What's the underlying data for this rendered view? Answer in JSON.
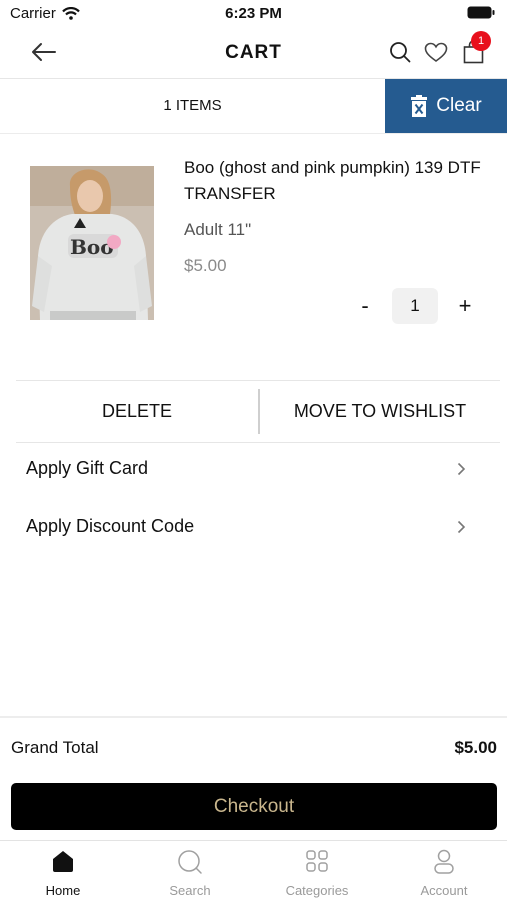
{
  "status_bar": {
    "carrier": "Carrier",
    "time": "6:23 PM"
  },
  "header": {
    "title": "CART",
    "cart_badge": "1"
  },
  "items_bar": {
    "count": "1 ITEMS",
    "clear_label": "Clear"
  },
  "product": {
    "name": "Boo (ghost and pink pumpkin) 139 DTF TRANSFER",
    "variant": "Adult 11\"",
    "price": "$5.00",
    "quantity": "1",
    "minus": "-",
    "plus": "+"
  },
  "actions": {
    "delete": "DELETE",
    "wishlist": "MOVE TO WISHLIST"
  },
  "options": [
    {
      "label": "Apply Gift Card"
    },
    {
      "label": "Apply Discount Code"
    }
  ],
  "summary": {
    "grand_total_label": "Grand Total",
    "grand_total_value": "$5.00",
    "checkout_label": "Checkout"
  },
  "tabs": [
    {
      "label": "Home",
      "icon": "home-icon",
      "active": true
    },
    {
      "label": "Search",
      "icon": "search-icon",
      "active": false
    },
    {
      "label": "Categories",
      "icon": "categories-icon",
      "active": false
    },
    {
      "label": "Account",
      "icon": "account-icon",
      "active": false
    }
  ],
  "colors": {
    "clear_button": "#255b90",
    "badge": "#e8101c",
    "checkout_bg": "#000000",
    "checkout_text": "#c9b68d"
  }
}
